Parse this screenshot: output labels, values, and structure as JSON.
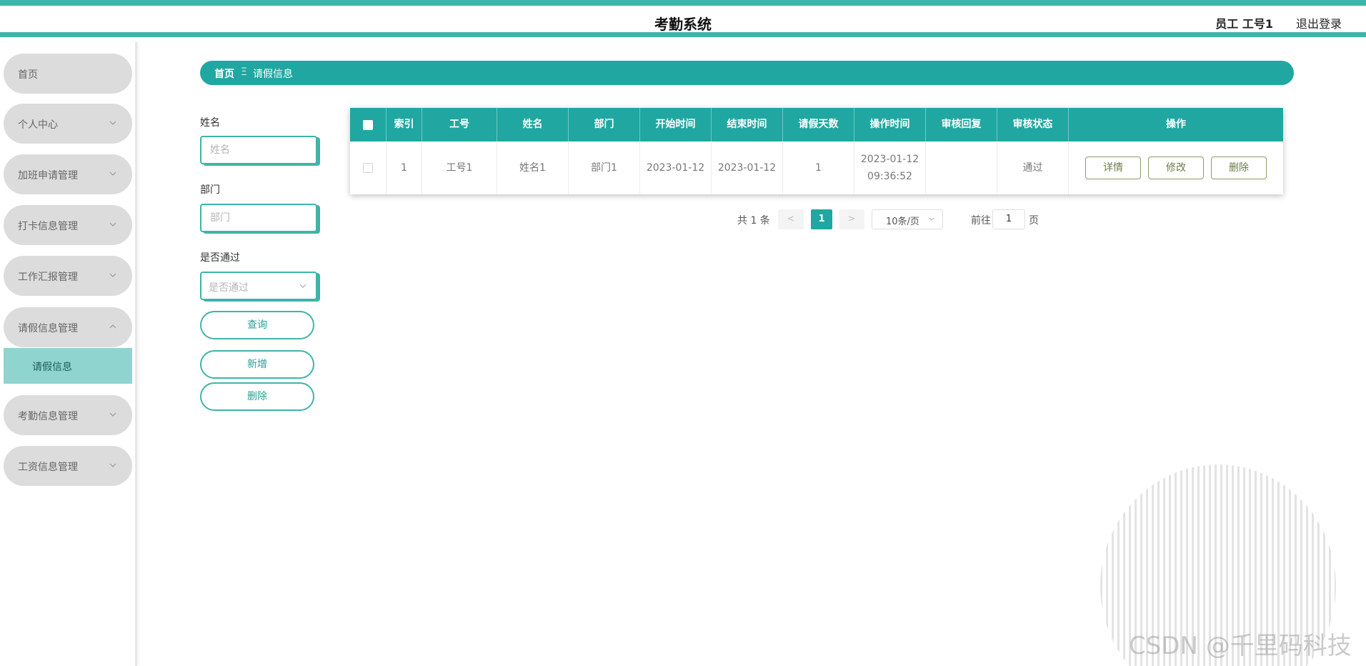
{
  "header": {
    "title": "考勤系统",
    "user": "员工 工号1",
    "logout": "退出登录"
  },
  "sidebar": {
    "items": [
      {
        "label": "首页"
      },
      {
        "label": "个人中心"
      },
      {
        "label": "加班申请管理"
      },
      {
        "label": "打卡信息管理"
      },
      {
        "label": "工作汇报管理"
      },
      {
        "label": "请假信息管理"
      },
      {
        "label": "考勤信息管理"
      },
      {
        "label": "工资信息管理"
      }
    ],
    "active_sub": "请假信息"
  },
  "breadcrumb": {
    "home": "首页",
    "separator": "Ξ",
    "current": "请假信息"
  },
  "search": {
    "name_label": "姓名",
    "name_placeholder": "姓名",
    "dept_label": "部门",
    "dept_placeholder": "部门",
    "pass_label": "是否通过",
    "pass_placeholder": "是否通过",
    "query_btn": "查询",
    "add_btn": "新增",
    "delete_btn": "删除"
  },
  "table": {
    "columns": [
      "索引",
      "工号",
      "姓名",
      "部门",
      "开始时间",
      "结束时间",
      "请假天数",
      "操作时间",
      "审核回复",
      "审核状态",
      "操作"
    ],
    "rows": [
      {
        "index": "1",
        "emp_no": "工号1",
        "name": "姓名1",
        "dept": "部门1",
        "start": "2023-01-12",
        "end": "2023-01-12",
        "days": "1",
        "op_date": "2023-01-12",
        "op_time": "09:36:52",
        "reply": "",
        "status": "通过",
        "actions": [
          "详情",
          "修改",
          "删除"
        ]
      }
    ]
  },
  "pagination": {
    "total": "共 1 条",
    "prev": "<",
    "current": "1",
    "next": ">",
    "page_size": "10条/页",
    "goto_label": "前往",
    "goto_value": "1",
    "page_suffix": "页"
  },
  "watermark": "CSDN @千里码科技",
  "colors": {
    "primary": "#20a7a1",
    "accent": "#3fb4a9",
    "active_sub_bg": "#8fd4cf",
    "menu_bg": "#dcdcdc"
  }
}
